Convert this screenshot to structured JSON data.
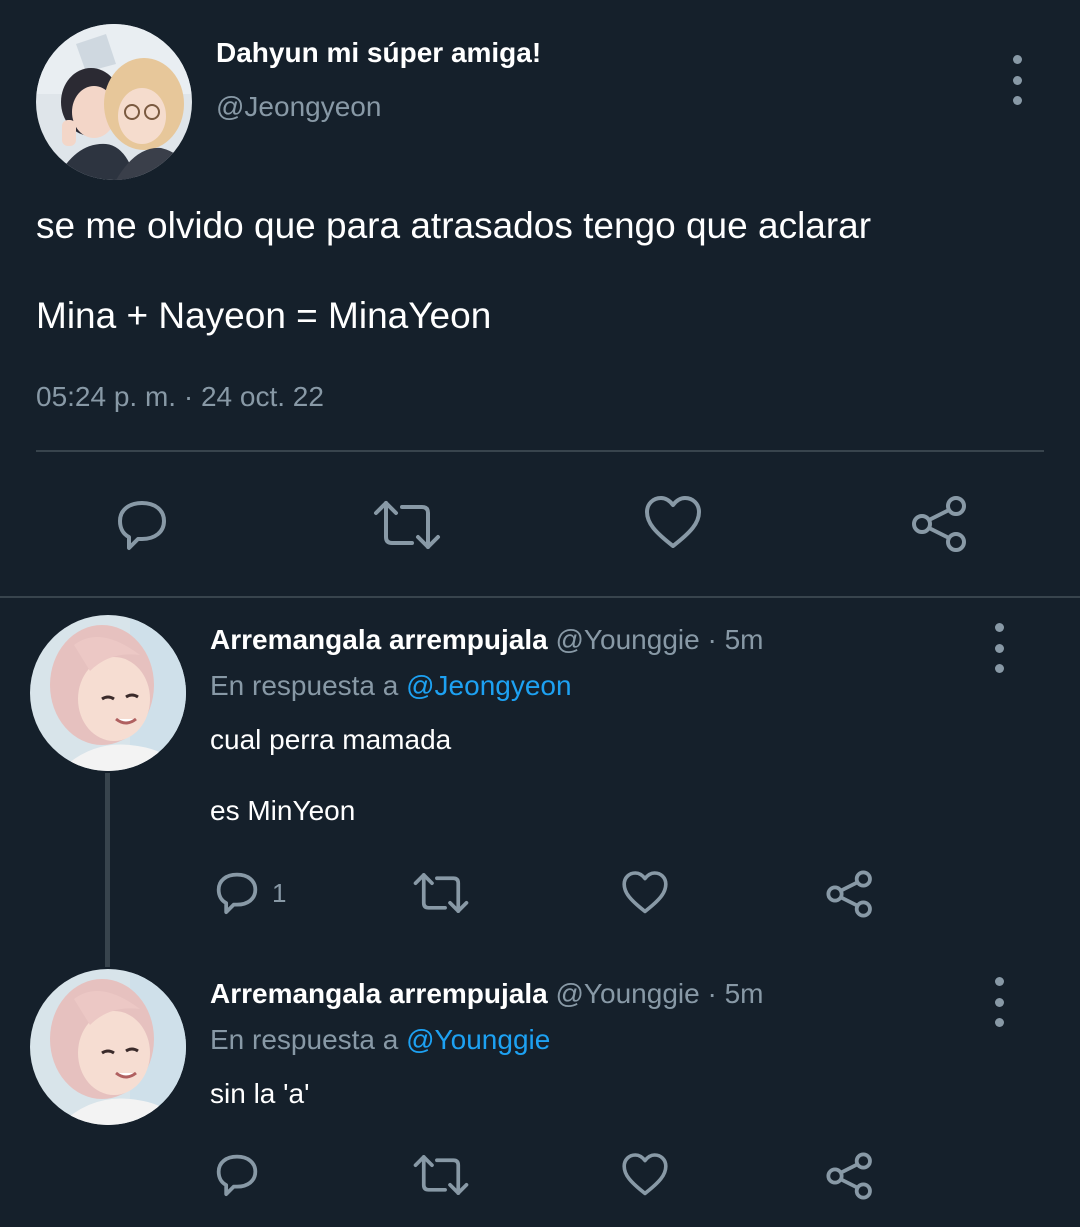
{
  "main_tweet": {
    "display_name": "Dahyun mi súper amiga!",
    "handle": "@Jeongyeon",
    "text_line1": "se me olvido que para atrasados tengo que aclarar",
    "text_line2": "Mina + Nayeon = MinaYeon",
    "timestamp": "05:24 p. m. · 24 oct. 22"
  },
  "replies": [
    {
      "display_name": "Arremangala arrempujala",
      "handle": "@Younggie",
      "time": " · 5m",
      "reply_prefix": "En respuesta a ",
      "reply_to": "@Jeongyeon",
      "text_line1": "cual perra mamada",
      "text_line2": "es MinYeon",
      "reply_count": "1"
    },
    {
      "display_name": "Arremangala arrempujala",
      "handle": "@Younggie",
      "time": " · 5m",
      "reply_prefix": "En respuesta a ",
      "reply_to": "@Younggie",
      "text_line1": "sin la 'a'"
    }
  ],
  "icons": {
    "reply": "reply-icon",
    "retweet": "retweet-icon",
    "like": "heart-icon",
    "share": "share-icon",
    "more": "more-options-icon"
  },
  "colors": {
    "background": "#15202b",
    "text": "#ffffff",
    "muted": "#8899a6",
    "link": "#1da1f2",
    "divider": "#38444d"
  }
}
